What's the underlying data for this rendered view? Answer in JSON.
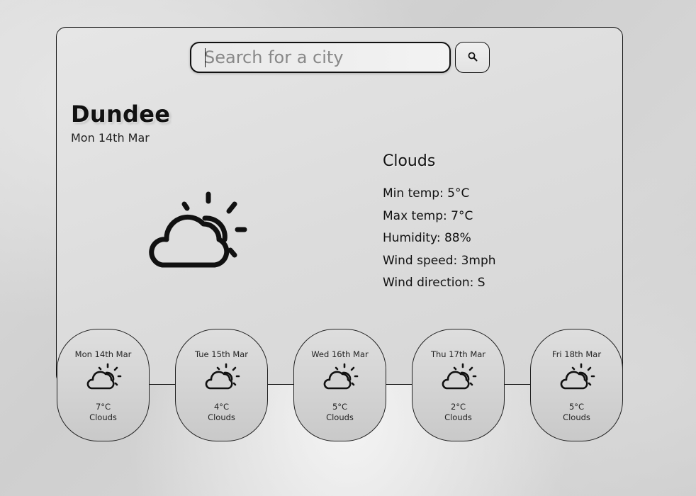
{
  "search": {
    "placeholder": "Search for a city",
    "value": ""
  },
  "icons": {
    "search_button": "search-icon",
    "weather": "partly-cloudy-icon"
  },
  "current": {
    "city": "Dundee",
    "date": "Mon 14th Mar",
    "condition": "Clouds",
    "details": [
      "Min temp: 5°C",
      "Max temp: 7°C",
      "Humidity: 88%",
      "Wind speed: 3mph",
      "Wind direction: S"
    ]
  },
  "forecast": [
    {
      "date": "Mon 14th Mar",
      "temp": "7°C",
      "condition": "Clouds"
    },
    {
      "date": "Tue 15th Mar",
      "temp": "4°C",
      "condition": "Clouds"
    },
    {
      "date": "Wed 16th Mar",
      "temp": "5°C",
      "condition": "Clouds"
    },
    {
      "date": "Thu 17th Mar",
      "temp": "2°C",
      "condition": "Clouds"
    },
    {
      "date": "Fri 18th Mar",
      "temp": "5°C",
      "condition": "Clouds"
    }
  ],
  "colors": {
    "outline": "#111111",
    "card_background": "#dcdcdc"
  }
}
